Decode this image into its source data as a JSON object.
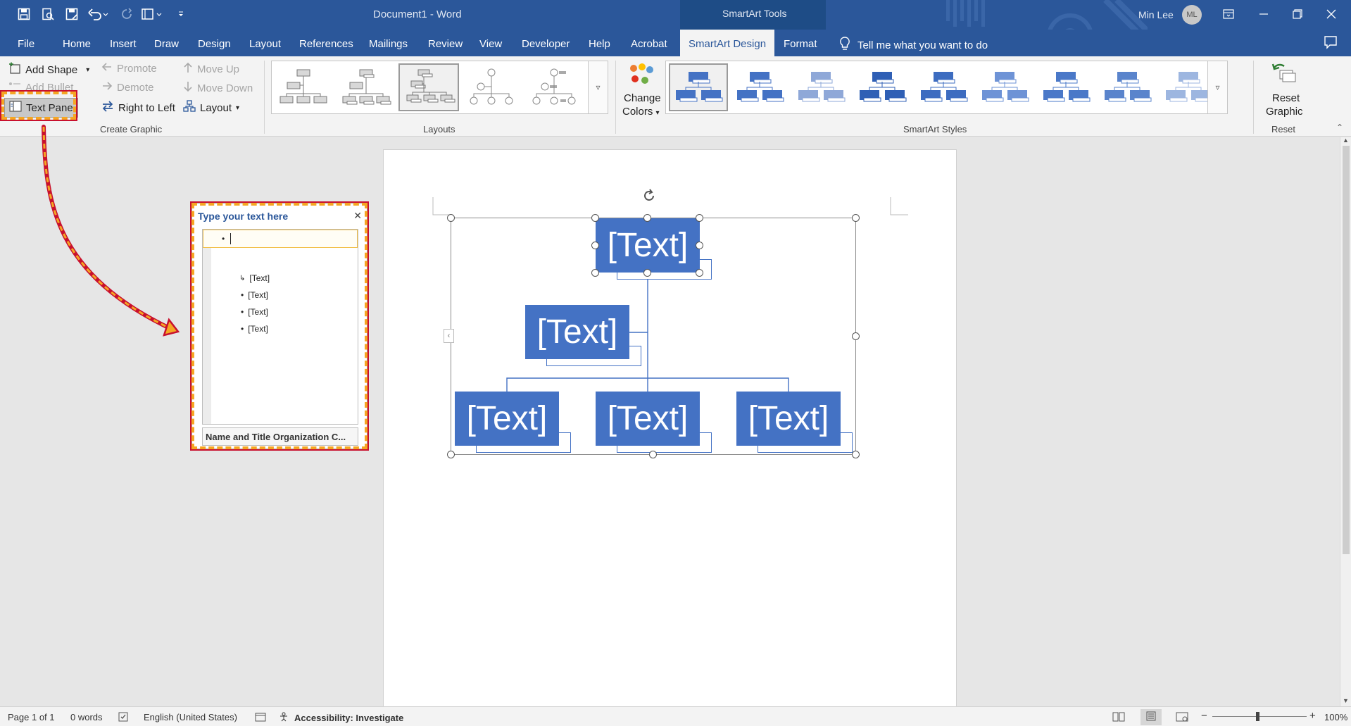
{
  "titlebar": {
    "document_title": "Document1  -  Word",
    "contextual_group": "SmartArt Tools",
    "user_name": "Min Lee",
    "user_initials": "ML"
  },
  "tabs": [
    {
      "label": "File"
    },
    {
      "label": "Home"
    },
    {
      "label": "Insert"
    },
    {
      "label": "Draw"
    },
    {
      "label": "Design"
    },
    {
      "label": "Layout"
    },
    {
      "label": "References"
    },
    {
      "label": "Mailings"
    },
    {
      "label": "Review"
    },
    {
      "label": "View"
    },
    {
      "label": "Developer"
    },
    {
      "label": "Help"
    },
    {
      "label": "Acrobat"
    },
    {
      "label": "SmartArt Design"
    },
    {
      "label": "Format"
    }
  ],
  "tellme": "Tell me what you want to do",
  "ribbon": {
    "create_graphic": {
      "add_shape": "Add Shape",
      "add_bullet": "Add Bullet",
      "text_pane": "Text Pane",
      "promote": "Promote",
      "demote": "Demote",
      "right_to_left": "Right to Left",
      "move_up": "Move Up",
      "move_down": "Move Down",
      "layout": "Layout",
      "group_label": "Create Graphic"
    },
    "layouts": {
      "group_label": "Layouts"
    },
    "change_colors": {
      "line1": "Change",
      "line2": "Colors"
    },
    "smartart_styles": {
      "group_label": "SmartArt Styles"
    },
    "reset": {
      "line1": "Reset",
      "line2": "Graphic",
      "group_label": "Reset"
    }
  },
  "text_pane": {
    "title": "Type your text here",
    "items": [
      "[Text]",
      "[Text]",
      "[Text]",
      "[Text]"
    ],
    "footer": "Name and Title Organization C..."
  },
  "smartart": {
    "nodes": [
      "[Text]",
      "[Text]",
      "[Text]",
      "[Text]",
      "[Text]"
    ]
  },
  "statusbar": {
    "page": "Page 1 of 1",
    "words": "0 words",
    "language": "English (United States)",
    "accessibility": "Accessibility: Investigate",
    "zoom": "100%"
  },
  "colors": {
    "word_blue": "#2b579a",
    "smartart_blue": "#4472c4",
    "highlight_border": "#c8102e",
    "highlight_dash": "#f5a623"
  }
}
